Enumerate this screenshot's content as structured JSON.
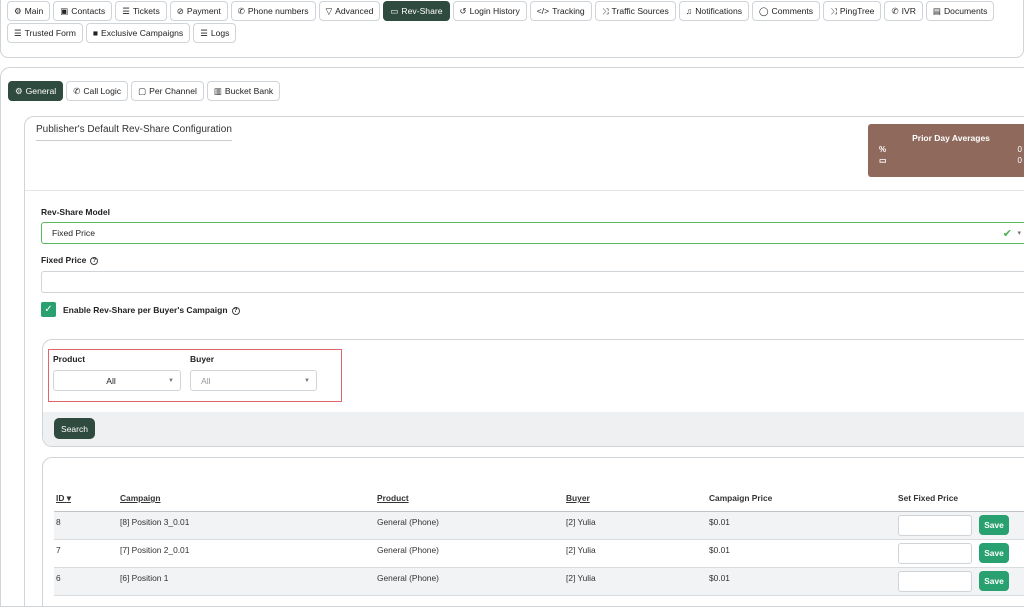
{
  "top_tabs_row1": [
    {
      "label": "Main",
      "icon": "⚙"
    },
    {
      "label": "Contacts",
      "icon": "▣"
    },
    {
      "label": "Tickets",
      "icon": "☰"
    },
    {
      "label": "Payment",
      "icon": "⊘"
    },
    {
      "label": "Phone numbers",
      "icon": "✆"
    },
    {
      "label": "Advanced",
      "icon": "▽"
    },
    {
      "label": "Rev-Share",
      "icon": "▭",
      "active": true
    },
    {
      "label": "Login History",
      "icon": "↺"
    },
    {
      "label": "Tracking",
      "icon": "</>"
    },
    {
      "label": "Traffic Sources",
      "icon": "⤨"
    },
    {
      "label": "Notifications",
      "icon": "♫"
    },
    {
      "label": "Comments",
      "icon": "◯"
    },
    {
      "label": "PingTree",
      "icon": "⤨"
    },
    {
      "label": "IVR",
      "icon": "✆"
    },
    {
      "label": "Documents",
      "icon": "▤"
    }
  ],
  "top_tabs_row2": [
    {
      "label": "Trusted Form",
      "icon": "☰"
    },
    {
      "label": "Exclusive Campaigns",
      "icon": "■"
    },
    {
      "label": "Logs",
      "icon": "☰"
    }
  ],
  "sub_tabs": [
    {
      "label": "General",
      "icon": "⚙",
      "active": true
    },
    {
      "label": "Call Logic",
      "icon": "✆"
    },
    {
      "label": "Per Channel",
      "icon": "▢"
    },
    {
      "label": "Bucket Bank",
      "icon": "▥"
    }
  ],
  "card": {
    "title": "Publisher's Default Rev-Share Configuration"
  },
  "prior_day": {
    "title": "Prior Day Averages",
    "row1_symbol": "%",
    "row1_value": "0",
    "row2_symbol": "▭",
    "row2_value": "0"
  },
  "form": {
    "model_label": "Rev-Share Model",
    "model_value": "Fixed Price",
    "fixed_price_label": "Fixed Price",
    "fixed_price_value": "",
    "enable_label": "Enable Rev-Share per Buyer's Campaign",
    "enable_checked": true
  },
  "filters": {
    "product_label": "Product",
    "product_value": "All",
    "buyer_label": "Buyer",
    "buyer_value": "All",
    "search_label": "Search"
  },
  "table": {
    "headers": [
      "ID",
      "Campaign",
      "Product",
      "Buyer",
      "Campaign Price",
      "Set Fixed Price"
    ],
    "sort_indicator": "▾",
    "rows": [
      {
        "id": "8",
        "campaign": "[8] Position 3_0.01",
        "product": "General (Phone)",
        "buyer": "[2] Yulia",
        "price": "$0.01",
        "fixed": ""
      },
      {
        "id": "7",
        "campaign": "[7] Position 2_0.01",
        "product": "General (Phone)",
        "buyer": "[2] Yulia",
        "price": "$0.01",
        "fixed": ""
      },
      {
        "id": "6",
        "campaign": "[6] Position 1",
        "product": "General (Phone)",
        "buyer": "[2] Yulia",
        "price": "$0.01",
        "fixed": ""
      }
    ],
    "save_label": "Save"
  },
  "colors": {
    "active_tab": "#2f4a3e",
    "save_green": "#28a06f",
    "avg_box": "#8f6a5c",
    "filter_outline": "#e0656b"
  }
}
